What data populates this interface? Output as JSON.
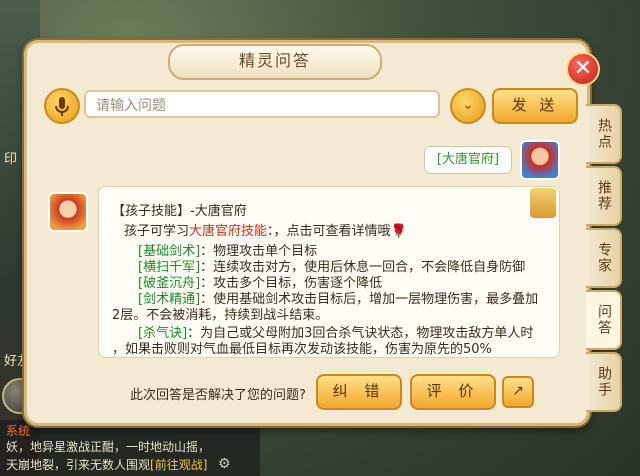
{
  "background": {
    "left_labels": [
      "印",
      "好友"
    ],
    "system_tag": "系统",
    "chat_lines": [
      {
        "text": "妖，地异星激战正酣，一时地动山摇，",
        "link": ""
      },
      {
        "text": "天崩地裂，引来无数人围观",
        "link": "[前往观战]"
      }
    ]
  },
  "dialog": {
    "title": "精灵问答",
    "close_symbol": "✕",
    "input_placeholder": "请输入问题",
    "dropdown_symbol": "⌄",
    "send_label": "发 送"
  },
  "conversation": {
    "user_message": "[大唐官府]",
    "answer": {
      "heading": "【孩子技能】-大唐官府",
      "intro_prefix": "孩子可学习",
      "intro_highlight": "大唐官府技能",
      "intro_suffix": "：，点击可查看详情哦",
      "flower": "🌹",
      "skills": [
        {
          "name": "[基础剑术]",
          "desc": "：物理攻击单个目标"
        },
        {
          "name": "[横扫千军]",
          "desc": "：连续攻击对方，使用后休息一回合，不会降低自身防御"
        },
        {
          "name": "[破釜沉舟]",
          "desc": "：攻击多个目标，伤害逐个降低"
        },
        {
          "name": "[剑术精通]",
          "desc": "：使用基础剑术攻击目标后，增加一层物理伤害，最多叠加"
        },
        {
          "name": "",
          "desc": "2层。不会被消耗，持续到战斗结束。"
        },
        {
          "name": "[杀气诀]",
          "desc": "：为自己或父母附加3回合杀气诀状态，物理攻击敌方单人时"
        },
        {
          "name": "",
          "desc": "，如果击败则对气血最低目标再次发动该技能，伤害为原先的50%"
        }
      ]
    }
  },
  "feedback": {
    "question": "此次回答是否解决了您的问题?",
    "correct_label": "纠 错",
    "rate_label": "评 价",
    "share_symbol": "↗"
  },
  "side_tabs": [
    {
      "label": "热点",
      "active": false
    },
    {
      "label": "推荐",
      "active": false
    },
    {
      "label": "专家",
      "active": false
    },
    {
      "label": "问答",
      "active": true
    },
    {
      "label": "助手",
      "active": false
    }
  ]
}
